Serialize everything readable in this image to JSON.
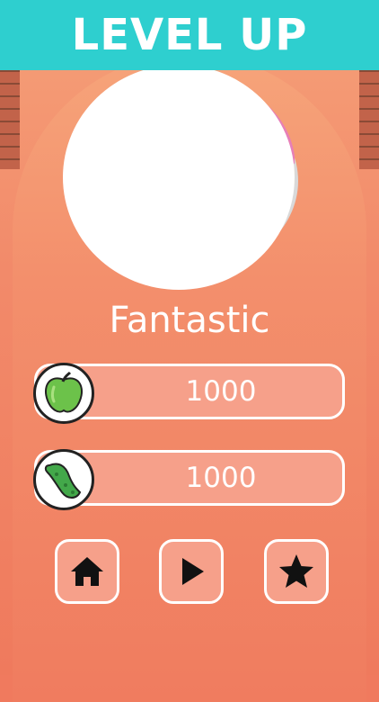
{
  "banner": {
    "title": "LEVEL UP"
  },
  "result": {
    "message": "Fantastic"
  },
  "stats": [
    {
      "icon": "green-apple-icon",
      "value": "1000"
    },
    {
      "icon": "pickle-icon",
      "value": "1000"
    }
  ],
  "buttons": [
    {
      "icon": "home-icon"
    },
    {
      "icon": "play-icon"
    },
    {
      "icon": "star-icon"
    }
  ],
  "colors": {
    "banner": "#2ecfcf",
    "background": "#f07a5e",
    "donut_frosting": "#e77fb8",
    "donut_dough": "#f4c27a"
  }
}
